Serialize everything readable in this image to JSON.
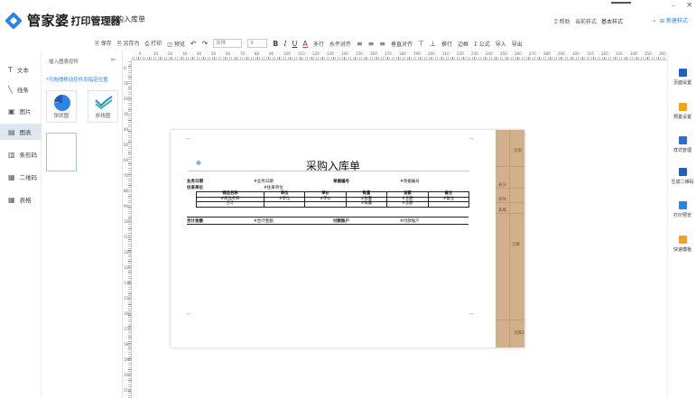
{
  "app": {
    "logo_text": "管家婆",
    "logo_sub": "打印管理器",
    "document_title": "采购入库单",
    "help_label": "帮助",
    "style_label": "当前样式",
    "style_value": "基本样式",
    "new_style_label": "新建样式"
  },
  "toolbar": {
    "items": [
      "保存",
      "另存为",
      "打印",
      "预览"
    ],
    "font_name": "宋体",
    "font_size": "9",
    "format_items": [
      "B",
      "I",
      "U",
      "A",
      "多行",
      "水平对齐",
      "垂直对齐"
    ],
    "tail_items": [
      "换行",
      "边框",
      "公式",
      "导入",
      "导出"
    ]
  },
  "left_nav": {
    "items": [
      {
        "label": "文本",
        "icon": "text-icon"
      },
      {
        "label": "线条",
        "icon": "line-icon"
      },
      {
        "label": "图片",
        "icon": "image-icon"
      },
      {
        "label": "图表",
        "icon": "chart-icon"
      },
      {
        "label": "条形码",
        "icon": "barcode-icon"
      },
      {
        "label": "二维码",
        "icon": "qrcode-icon"
      },
      {
        "label": "表格",
        "icon": "table-icon"
      }
    ],
    "active_index": 3
  },
  "component_panel": {
    "title": "插入图表控件",
    "hint": "*可拖拽移动控件到指定位置",
    "cards": [
      {
        "label": "饼状图",
        "icon": "pie-chart-icon"
      },
      {
        "label": "折线图",
        "icon": "line-chart-icon"
      }
    ]
  },
  "ruler": {
    "top_ticks": [
      "0",
      "10",
      "20",
      "30",
      "40",
      "50",
      "60",
      "70",
      "80",
      "90",
      "100",
      "110",
      "120",
      "130",
      "140",
      "150",
      "160",
      "170",
      "180",
      "190",
      "200",
      "210",
      "220",
      "230",
      "240",
      "250",
      "260",
      "270",
      "280",
      "290",
      "300",
      "310",
      "320",
      "330",
      "340",
      "350",
      "360"
    ],
    "left_ticks": [
      "0",
      "10",
      "20",
      "30",
      "40",
      "50",
      "60",
      "70",
      "80",
      "90",
      "100",
      "110",
      "120",
      "130",
      "140",
      "150",
      "160",
      "170",
      "180",
      "190",
      "200",
      "210"
    ]
  },
  "form": {
    "title": "采购入库单",
    "info_rows": [
      [
        {
          "label": "业务日期",
          "value": "#业务日期"
        },
        {
          "label": "单据编号",
          "value": "#单据编号"
        }
      ],
      [
        {
          "label": "往来单位",
          "value": "#往来单位"
        }
      ]
    ],
    "table": {
      "headers": [
        "商品名称",
        "单位",
        "单价",
        "数量",
        "金额",
        "备注"
      ],
      "row": [
        "#商品名称",
        "#单位",
        "#单价",
        "#数量",
        "#金额",
        "#备注"
      ],
      "total_row": [
        "合计",
        "",
        "",
        "#数量",
        "#金额",
        ""
      ]
    },
    "summary": [
      {
        "label": "合计金额",
        "value": "#合计金额"
      },
      {
        "label": "付款账户",
        "value": "#付款账户"
      }
    ],
    "side_labels": [
      "页眉",
      "表头",
      "表体",
      "表尾",
      "页脚",
      "页脚2"
    ]
  },
  "right_panel": {
    "items": [
      {
        "label": "页面设置",
        "icon": "page-settings-icon",
        "color": "#1f5fbf"
      },
      {
        "label": "预置设置",
        "icon": "preset-icon",
        "color": "#f2a31b"
      },
      {
        "label": "样式管理",
        "icon": "style-manage-icon",
        "color": "#2b6fd6"
      },
      {
        "label": "生成二维码",
        "icon": "qrcode-gen-icon",
        "color": "#1f5fbf"
      },
      {
        "label": "打印预览",
        "icon": "print-preview-icon",
        "color": "#2b84e6"
      },
      {
        "label": "快速模板",
        "icon": "template-icon",
        "color": "#f2a31b"
      }
    ]
  }
}
